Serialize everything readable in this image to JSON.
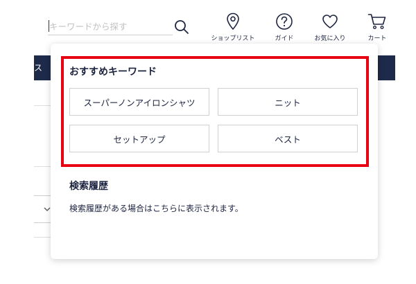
{
  "header": {
    "search": {
      "placeholder": "キーワードから探す",
      "value": ""
    },
    "nav": [
      {
        "label": "ショップリスト",
        "icon": "map-pin-icon"
      },
      {
        "label": "ガイド",
        "icon": "help-circle-icon"
      },
      {
        "label": "お気に入り",
        "icon": "heart-icon"
      },
      {
        "label": "カート",
        "icon": "cart-icon"
      }
    ]
  },
  "navbar": {
    "partial_label": "ス"
  },
  "dropdown": {
    "recommended": {
      "title": "おすすめキーワード",
      "keywords": [
        "スーパーノンアイロンシャツ",
        "ニット",
        "セットアップ",
        "ベスト"
      ]
    },
    "history": {
      "title": "検索履歴",
      "message": "検索履歴がある場合はこちらに表示されます。"
    }
  },
  "colors": {
    "accent": "#1d2440",
    "navbar": "#1e2a4a",
    "highlight": "#e60012"
  }
}
